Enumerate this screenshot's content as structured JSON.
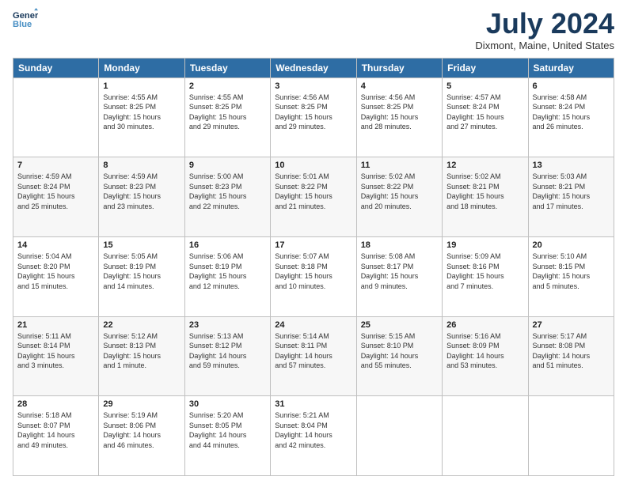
{
  "header": {
    "logo_line1": "General",
    "logo_line2": "Blue",
    "title": "July 2024",
    "location": "Dixmont, Maine, United States"
  },
  "weekdays": [
    "Sunday",
    "Monday",
    "Tuesday",
    "Wednesday",
    "Thursday",
    "Friday",
    "Saturday"
  ],
  "weeks": [
    [
      {
        "day": "",
        "content": ""
      },
      {
        "day": "1",
        "content": "Sunrise: 4:55 AM\nSunset: 8:25 PM\nDaylight: 15 hours\nand 30 minutes."
      },
      {
        "day": "2",
        "content": "Sunrise: 4:55 AM\nSunset: 8:25 PM\nDaylight: 15 hours\nand 29 minutes."
      },
      {
        "day": "3",
        "content": "Sunrise: 4:56 AM\nSunset: 8:25 PM\nDaylight: 15 hours\nand 29 minutes."
      },
      {
        "day": "4",
        "content": "Sunrise: 4:56 AM\nSunset: 8:25 PM\nDaylight: 15 hours\nand 28 minutes."
      },
      {
        "day": "5",
        "content": "Sunrise: 4:57 AM\nSunset: 8:24 PM\nDaylight: 15 hours\nand 27 minutes."
      },
      {
        "day": "6",
        "content": "Sunrise: 4:58 AM\nSunset: 8:24 PM\nDaylight: 15 hours\nand 26 minutes."
      }
    ],
    [
      {
        "day": "7",
        "content": "Sunrise: 4:59 AM\nSunset: 8:24 PM\nDaylight: 15 hours\nand 25 minutes."
      },
      {
        "day": "8",
        "content": "Sunrise: 4:59 AM\nSunset: 8:23 PM\nDaylight: 15 hours\nand 23 minutes."
      },
      {
        "day": "9",
        "content": "Sunrise: 5:00 AM\nSunset: 8:23 PM\nDaylight: 15 hours\nand 22 minutes."
      },
      {
        "day": "10",
        "content": "Sunrise: 5:01 AM\nSunset: 8:22 PM\nDaylight: 15 hours\nand 21 minutes."
      },
      {
        "day": "11",
        "content": "Sunrise: 5:02 AM\nSunset: 8:22 PM\nDaylight: 15 hours\nand 20 minutes."
      },
      {
        "day": "12",
        "content": "Sunrise: 5:02 AM\nSunset: 8:21 PM\nDaylight: 15 hours\nand 18 minutes."
      },
      {
        "day": "13",
        "content": "Sunrise: 5:03 AM\nSunset: 8:21 PM\nDaylight: 15 hours\nand 17 minutes."
      }
    ],
    [
      {
        "day": "14",
        "content": "Sunrise: 5:04 AM\nSunset: 8:20 PM\nDaylight: 15 hours\nand 15 minutes."
      },
      {
        "day": "15",
        "content": "Sunrise: 5:05 AM\nSunset: 8:19 PM\nDaylight: 15 hours\nand 14 minutes."
      },
      {
        "day": "16",
        "content": "Sunrise: 5:06 AM\nSunset: 8:19 PM\nDaylight: 15 hours\nand 12 minutes."
      },
      {
        "day": "17",
        "content": "Sunrise: 5:07 AM\nSunset: 8:18 PM\nDaylight: 15 hours\nand 10 minutes."
      },
      {
        "day": "18",
        "content": "Sunrise: 5:08 AM\nSunset: 8:17 PM\nDaylight: 15 hours\nand 9 minutes."
      },
      {
        "day": "19",
        "content": "Sunrise: 5:09 AM\nSunset: 8:16 PM\nDaylight: 15 hours\nand 7 minutes."
      },
      {
        "day": "20",
        "content": "Sunrise: 5:10 AM\nSunset: 8:15 PM\nDaylight: 15 hours\nand 5 minutes."
      }
    ],
    [
      {
        "day": "21",
        "content": "Sunrise: 5:11 AM\nSunset: 8:14 PM\nDaylight: 15 hours\nand 3 minutes."
      },
      {
        "day": "22",
        "content": "Sunrise: 5:12 AM\nSunset: 8:13 PM\nDaylight: 15 hours\nand 1 minute."
      },
      {
        "day": "23",
        "content": "Sunrise: 5:13 AM\nSunset: 8:12 PM\nDaylight: 14 hours\nand 59 minutes."
      },
      {
        "day": "24",
        "content": "Sunrise: 5:14 AM\nSunset: 8:11 PM\nDaylight: 14 hours\nand 57 minutes."
      },
      {
        "day": "25",
        "content": "Sunrise: 5:15 AM\nSunset: 8:10 PM\nDaylight: 14 hours\nand 55 minutes."
      },
      {
        "day": "26",
        "content": "Sunrise: 5:16 AM\nSunset: 8:09 PM\nDaylight: 14 hours\nand 53 minutes."
      },
      {
        "day": "27",
        "content": "Sunrise: 5:17 AM\nSunset: 8:08 PM\nDaylight: 14 hours\nand 51 minutes."
      }
    ],
    [
      {
        "day": "28",
        "content": "Sunrise: 5:18 AM\nSunset: 8:07 PM\nDaylight: 14 hours\nand 49 minutes."
      },
      {
        "day": "29",
        "content": "Sunrise: 5:19 AM\nSunset: 8:06 PM\nDaylight: 14 hours\nand 46 minutes."
      },
      {
        "day": "30",
        "content": "Sunrise: 5:20 AM\nSunset: 8:05 PM\nDaylight: 14 hours\nand 44 minutes."
      },
      {
        "day": "31",
        "content": "Sunrise: 5:21 AM\nSunset: 8:04 PM\nDaylight: 14 hours\nand 42 minutes."
      },
      {
        "day": "",
        "content": ""
      },
      {
        "day": "",
        "content": ""
      },
      {
        "day": "",
        "content": ""
      }
    ]
  ]
}
